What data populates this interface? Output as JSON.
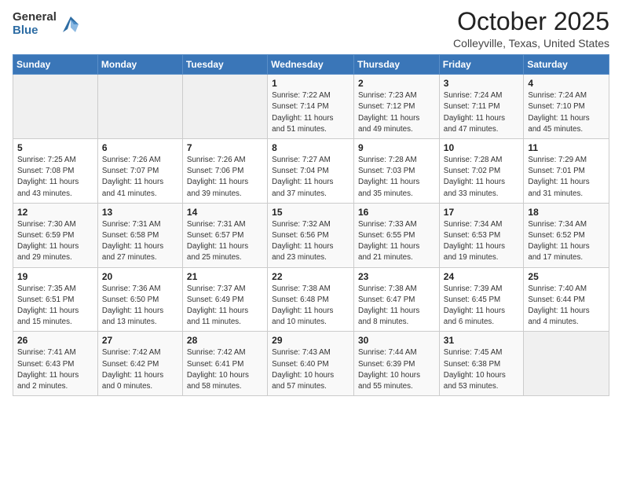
{
  "logo": {
    "general": "General",
    "blue": "Blue"
  },
  "header": {
    "month": "October 2025",
    "location": "Colleyville, Texas, United States"
  },
  "weekdays": [
    "Sunday",
    "Monday",
    "Tuesday",
    "Wednesday",
    "Thursday",
    "Friday",
    "Saturday"
  ],
  "weeks": [
    [
      {
        "day": "",
        "info": ""
      },
      {
        "day": "",
        "info": ""
      },
      {
        "day": "",
        "info": ""
      },
      {
        "day": "1",
        "info": "Sunrise: 7:22 AM\nSunset: 7:14 PM\nDaylight: 11 hours\nand 51 minutes."
      },
      {
        "day": "2",
        "info": "Sunrise: 7:23 AM\nSunset: 7:12 PM\nDaylight: 11 hours\nand 49 minutes."
      },
      {
        "day": "3",
        "info": "Sunrise: 7:24 AM\nSunset: 7:11 PM\nDaylight: 11 hours\nand 47 minutes."
      },
      {
        "day": "4",
        "info": "Sunrise: 7:24 AM\nSunset: 7:10 PM\nDaylight: 11 hours\nand 45 minutes."
      }
    ],
    [
      {
        "day": "5",
        "info": "Sunrise: 7:25 AM\nSunset: 7:08 PM\nDaylight: 11 hours\nand 43 minutes."
      },
      {
        "day": "6",
        "info": "Sunrise: 7:26 AM\nSunset: 7:07 PM\nDaylight: 11 hours\nand 41 minutes."
      },
      {
        "day": "7",
        "info": "Sunrise: 7:26 AM\nSunset: 7:06 PM\nDaylight: 11 hours\nand 39 minutes."
      },
      {
        "day": "8",
        "info": "Sunrise: 7:27 AM\nSunset: 7:04 PM\nDaylight: 11 hours\nand 37 minutes."
      },
      {
        "day": "9",
        "info": "Sunrise: 7:28 AM\nSunset: 7:03 PM\nDaylight: 11 hours\nand 35 minutes."
      },
      {
        "day": "10",
        "info": "Sunrise: 7:28 AM\nSunset: 7:02 PM\nDaylight: 11 hours\nand 33 minutes."
      },
      {
        "day": "11",
        "info": "Sunrise: 7:29 AM\nSunset: 7:01 PM\nDaylight: 11 hours\nand 31 minutes."
      }
    ],
    [
      {
        "day": "12",
        "info": "Sunrise: 7:30 AM\nSunset: 6:59 PM\nDaylight: 11 hours\nand 29 minutes."
      },
      {
        "day": "13",
        "info": "Sunrise: 7:31 AM\nSunset: 6:58 PM\nDaylight: 11 hours\nand 27 minutes."
      },
      {
        "day": "14",
        "info": "Sunrise: 7:31 AM\nSunset: 6:57 PM\nDaylight: 11 hours\nand 25 minutes."
      },
      {
        "day": "15",
        "info": "Sunrise: 7:32 AM\nSunset: 6:56 PM\nDaylight: 11 hours\nand 23 minutes."
      },
      {
        "day": "16",
        "info": "Sunrise: 7:33 AM\nSunset: 6:55 PM\nDaylight: 11 hours\nand 21 minutes."
      },
      {
        "day": "17",
        "info": "Sunrise: 7:34 AM\nSunset: 6:53 PM\nDaylight: 11 hours\nand 19 minutes."
      },
      {
        "day": "18",
        "info": "Sunrise: 7:34 AM\nSunset: 6:52 PM\nDaylight: 11 hours\nand 17 minutes."
      }
    ],
    [
      {
        "day": "19",
        "info": "Sunrise: 7:35 AM\nSunset: 6:51 PM\nDaylight: 11 hours\nand 15 minutes."
      },
      {
        "day": "20",
        "info": "Sunrise: 7:36 AM\nSunset: 6:50 PM\nDaylight: 11 hours\nand 13 minutes."
      },
      {
        "day": "21",
        "info": "Sunrise: 7:37 AM\nSunset: 6:49 PM\nDaylight: 11 hours\nand 11 minutes."
      },
      {
        "day": "22",
        "info": "Sunrise: 7:38 AM\nSunset: 6:48 PM\nDaylight: 11 hours\nand 10 minutes."
      },
      {
        "day": "23",
        "info": "Sunrise: 7:38 AM\nSunset: 6:47 PM\nDaylight: 11 hours\nand 8 minutes."
      },
      {
        "day": "24",
        "info": "Sunrise: 7:39 AM\nSunset: 6:45 PM\nDaylight: 11 hours\nand 6 minutes."
      },
      {
        "day": "25",
        "info": "Sunrise: 7:40 AM\nSunset: 6:44 PM\nDaylight: 11 hours\nand 4 minutes."
      }
    ],
    [
      {
        "day": "26",
        "info": "Sunrise: 7:41 AM\nSunset: 6:43 PM\nDaylight: 11 hours\nand 2 minutes."
      },
      {
        "day": "27",
        "info": "Sunrise: 7:42 AM\nSunset: 6:42 PM\nDaylight: 11 hours\nand 0 minutes."
      },
      {
        "day": "28",
        "info": "Sunrise: 7:42 AM\nSunset: 6:41 PM\nDaylight: 10 hours\nand 58 minutes."
      },
      {
        "day": "29",
        "info": "Sunrise: 7:43 AM\nSunset: 6:40 PM\nDaylight: 10 hours\nand 57 minutes."
      },
      {
        "day": "30",
        "info": "Sunrise: 7:44 AM\nSunset: 6:39 PM\nDaylight: 10 hours\nand 55 minutes."
      },
      {
        "day": "31",
        "info": "Sunrise: 7:45 AM\nSunset: 6:38 PM\nDaylight: 10 hours\nand 53 minutes."
      },
      {
        "day": "",
        "info": ""
      }
    ]
  ]
}
